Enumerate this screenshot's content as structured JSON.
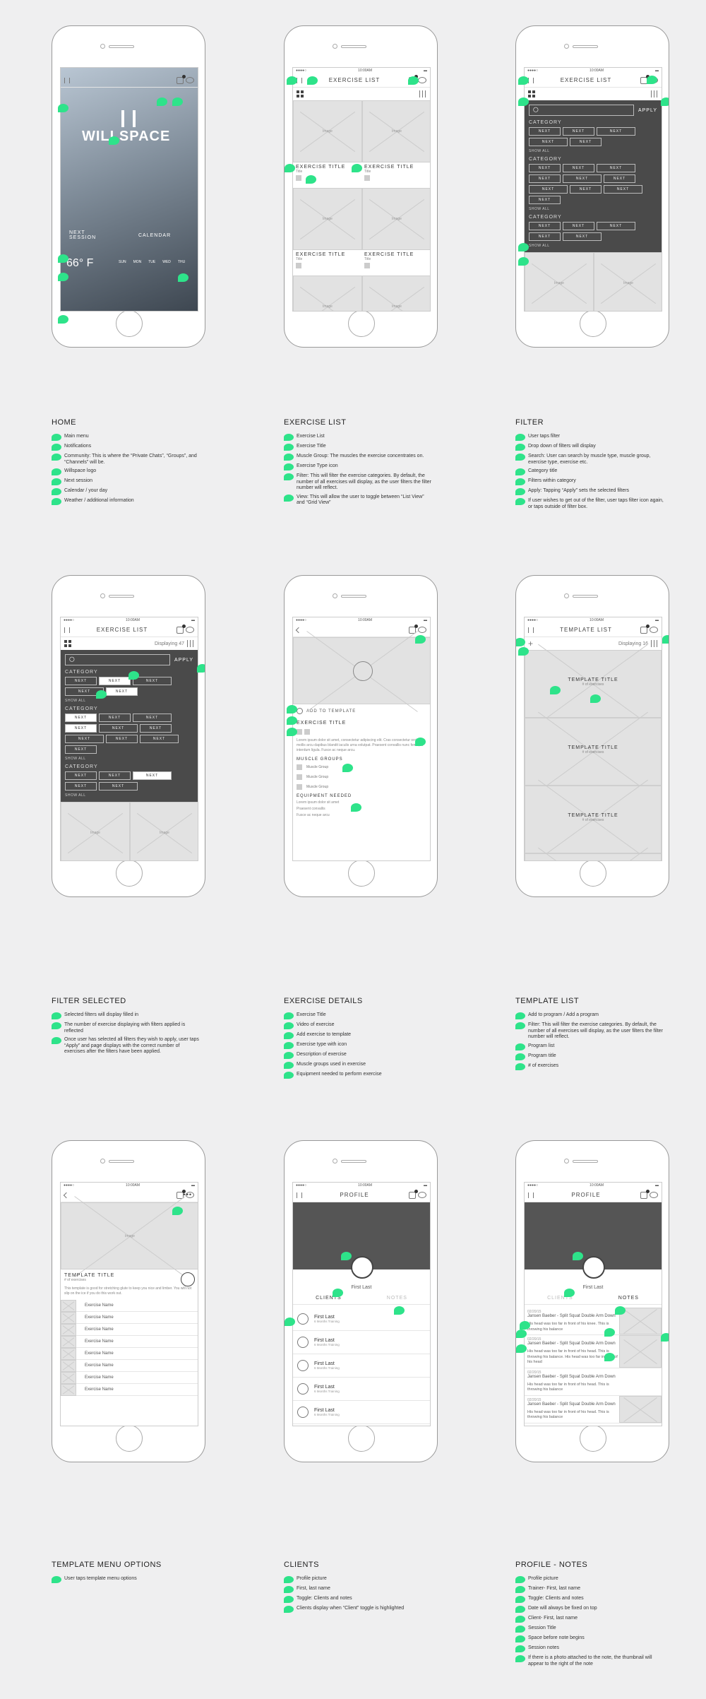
{
  "status": {
    "time": "10:00AM"
  },
  "home": {
    "brand": "WILLSPACE",
    "next_session": "NEXT\nSESSION",
    "calendar": "CALENDAR",
    "weather": "66° F",
    "days": [
      "SUN",
      "MON",
      "TUE",
      "WED",
      "THU"
    ]
  },
  "exercise_list": {
    "title": "EXERCISE LIST",
    "item_title": "EXERCISE TITLE",
    "item_sub": "Title",
    "image": "Image"
  },
  "filter": {
    "apply": "APPLY",
    "category": "CATEGORY",
    "next": "NEXT",
    "show_all": "SHOW ALL",
    "displaying": "Displaying 47"
  },
  "details": {
    "add": "ADD TO TEMPLATE",
    "title": "EXERCISE TITLE",
    "desc": "Lorem ipsum dolor sit amet, consectetur adipiscing elit. Cras consectetur orci mollis arcu dapibus blandit iaculis urna volutpat. Praesent convallis nunc ferus, in interdum ligula. Fusce ac neque arcu.",
    "mg_title": "MUSCLE GROUPS",
    "mg": [
      "Muscle Group",
      "Muscle Group",
      "Muscle Group"
    ],
    "eq_title": "EQUIPMENT NEEDED",
    "eq": [
      "Lorem ipsum dolor sit amet",
      "Praesent convallis",
      "Fusce ac neque arcu"
    ]
  },
  "template_list": {
    "title": "TEMPLATE LIST",
    "displaying": "Displaying 16",
    "item": "TEMPLATE TITLE",
    "item_sub": "# of exercises"
  },
  "template": {
    "title": "TEMPLATE TITLE",
    "sub": "# of exercises",
    "desc": "This template is good for stretching glute to keep you nice and limber. You will not slip on the ice if you do this work out.",
    "ex": "Exercise Name"
  },
  "profile": {
    "title": "PROFILE",
    "name": "First Last",
    "clients": "CLIENTS",
    "notes": "NOTES",
    "client_name": "First Last",
    "client_sub": "6 Months Training"
  },
  "notes": [
    {
      "date": "02/20/15",
      "title": "Jansen Baeber - Split Squat Double Arm Down",
      "body": "His head was too far in front of his knee. This is throwing his balance"
    },
    {
      "date": "02/20/15",
      "title": "Jansen Baeber - Split Squat Double Arm Down",
      "body": "His head was too far in front of his head. This is throwing his balance. His head was too far in front of his head"
    },
    {
      "date": "02/20/15",
      "title": "Jansen Baeber - Split Squat Double Arm Down",
      "body": "His head was too far in front of his head. This is throwing his balance"
    },
    {
      "date": "02/20/15",
      "title": "Jansen Baeber - Split Squat Double Arm Down",
      "body": "His head was too far in front of his head. This is throwing his balance"
    }
  ],
  "sections": [
    {
      "title": "HOME",
      "items": [
        "Main menu",
        "Notifications",
        "Community: This is where the “Private Chats”, “Groups”, and “Channels” will be.",
        "Willspace logo",
        "Next session",
        "Calendar / your day",
        "Weather / additional information"
      ]
    },
    {
      "title": "EXERCISE LIST",
      "items": [
        "Exercise List",
        "Exercise Title",
        "Muscle Group: The muscles the exercise concentrates on.",
        "Exercise Type icon",
        "Filter: This will filter the exercise categories. By default, the number of all exercises will display, as the user filters the filter number will reflect.",
        "View: This will allow the user to toggle between “List View” and “Grid View”"
      ]
    },
    {
      "title": "FILTER",
      "items": [
        "User taps filter",
        "Drop down of filters will display",
        "Search: User can search by muscle type, muscle group, exercise type, exercise etc.",
        "Category title",
        "Filters within category",
        "Apply: Tapping “Apply” sets the selected filters",
        "If user wishes to get out of the filter, user taps filter icon again, or taps outside of filter box."
      ]
    },
    {
      "title": "FILTER SELECTED",
      "items": [
        "Selected filters will display filled in",
        "The number of exercise displaying with filters applied is reflected",
        "Once user has selected all filters they wish to apply, user taps “Apply” and page displays with the correct number of exercises after the filters have been applied."
      ]
    },
    {
      "title": "EXERCISE DETAILS",
      "items": [
        "Exercise Title",
        "Video of exercise",
        "Add exercise to template",
        "Exercise type with icon",
        "Description of exercise",
        "Muscle groups used in exercise",
        "Equipment needed to perform exercise"
      ]
    },
    {
      "title": "TEMPLATE LIST",
      "items": [
        "Add to program / Add a program",
        "Filter: This will filter the exercise categories. By default, the number of all exercises will display, as the user filters the filter number will reflect.",
        "Program list",
        "Program title",
        "# of exercises"
      ]
    },
    {
      "title": "TEMPLATE MENU OPTIONS",
      "items": [
        "User taps template menu options"
      ]
    },
    {
      "title": "CLIENTS",
      "items": [
        "Profile picture",
        "First, last name",
        "Toggle: Clients and notes",
        "Clients display when “Client” toggle is highlighted"
      ]
    },
    {
      "title": "PROFILE - NOTES",
      "items": [
        "Profile picture",
        "Trainer- First, last name",
        "Toggle: Clients and notes",
        "Date will always be fixed on top",
        "Client- First, last name",
        "Session Title",
        "Space before note begins",
        "Session notes",
        "If there is a photo attached to the note, the thumbnail will appear to the right of the note"
      ]
    }
  ]
}
